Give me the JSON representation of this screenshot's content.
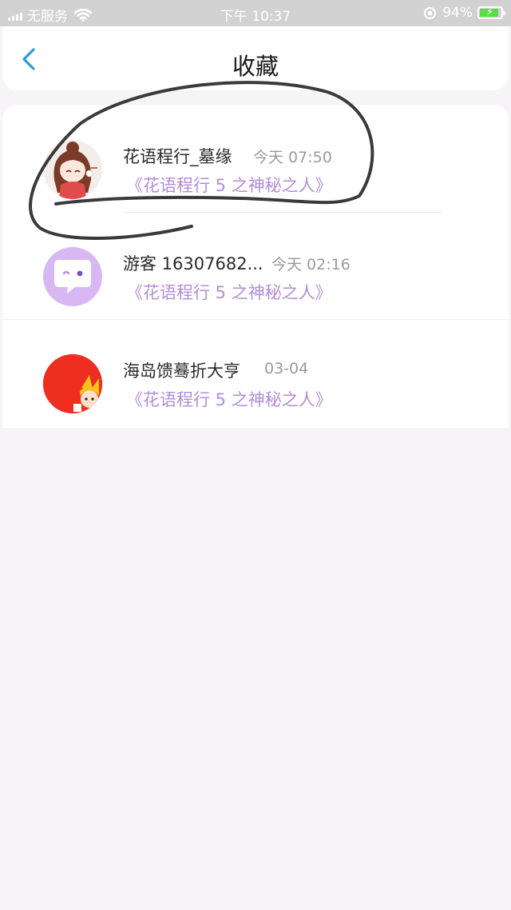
{
  "status_bar": {
    "carrier": "无服务",
    "time": "下午 10:37",
    "battery": "94%",
    "battery_level": 0.94,
    "battery_color": "#5ddc4a"
  },
  "header": {
    "title": "收藏",
    "back_icon": "chevron-left-icon",
    "accent": "#2f9bd9"
  },
  "favorites": [
    {
      "name": "花语程行_墓缘",
      "time": "今天 07:50",
      "book": "《花语程行 5 之神秘之人》"
    },
    {
      "name": "游客 16307682...",
      "time": "今天 02:16",
      "book": "《花语程行 5 之神秘之人》"
    },
    {
      "name": "海岛馈蓦折大亨",
      "time": "03-04",
      "book": "《花语程行 5 之神秘之人》"
    }
  ],
  "colors": {
    "book_title": "#b48cd8",
    "guest_avatar": "#d8b8f3",
    "red_avatar": "#ee2f20"
  }
}
